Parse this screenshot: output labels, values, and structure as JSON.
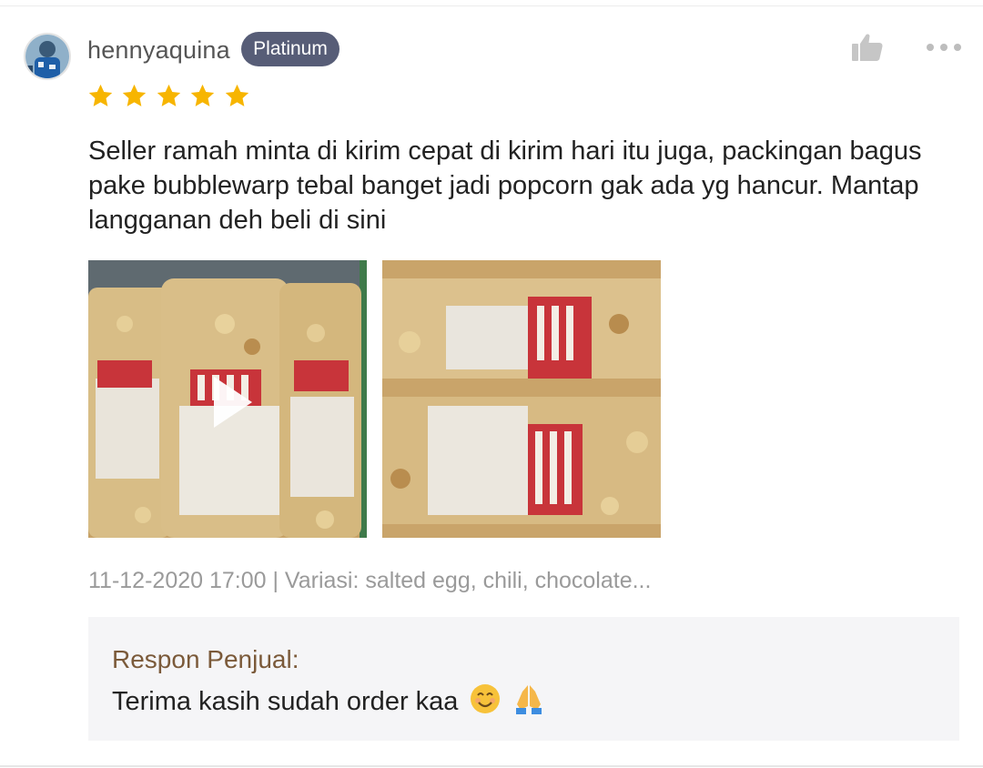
{
  "review": {
    "username": "hennyaquina",
    "badge": "Platinum",
    "rating": 5,
    "rating_max": 5,
    "text": "Seller ramah minta di kirim cepat di kirim hari itu juga, packingan bagus pake bubblewarp tebal banget jadi popcorn gak ada yg hancur. Mantap langganan deh beli di sini",
    "meta": "11-12-2020 17:00 | Variasi: salted egg, chili, chocolate...",
    "media": [
      {
        "kind": "video",
        "icon": "play-icon"
      },
      {
        "kind": "image"
      }
    ],
    "icons": {
      "like": "thumbs-up-icon",
      "more": "more-options-icon",
      "star": "star-icon"
    }
  },
  "seller_response": {
    "title": "Respon Penjual:",
    "message": "Terima kasih sudah order kaa"
  },
  "colors": {
    "badge_bg": "#575d77",
    "star": "#f7b500",
    "seller_title": "#7b5a3a",
    "meta_text": "#9a9a9a",
    "seller_box_bg": "#f5f5f7"
  }
}
